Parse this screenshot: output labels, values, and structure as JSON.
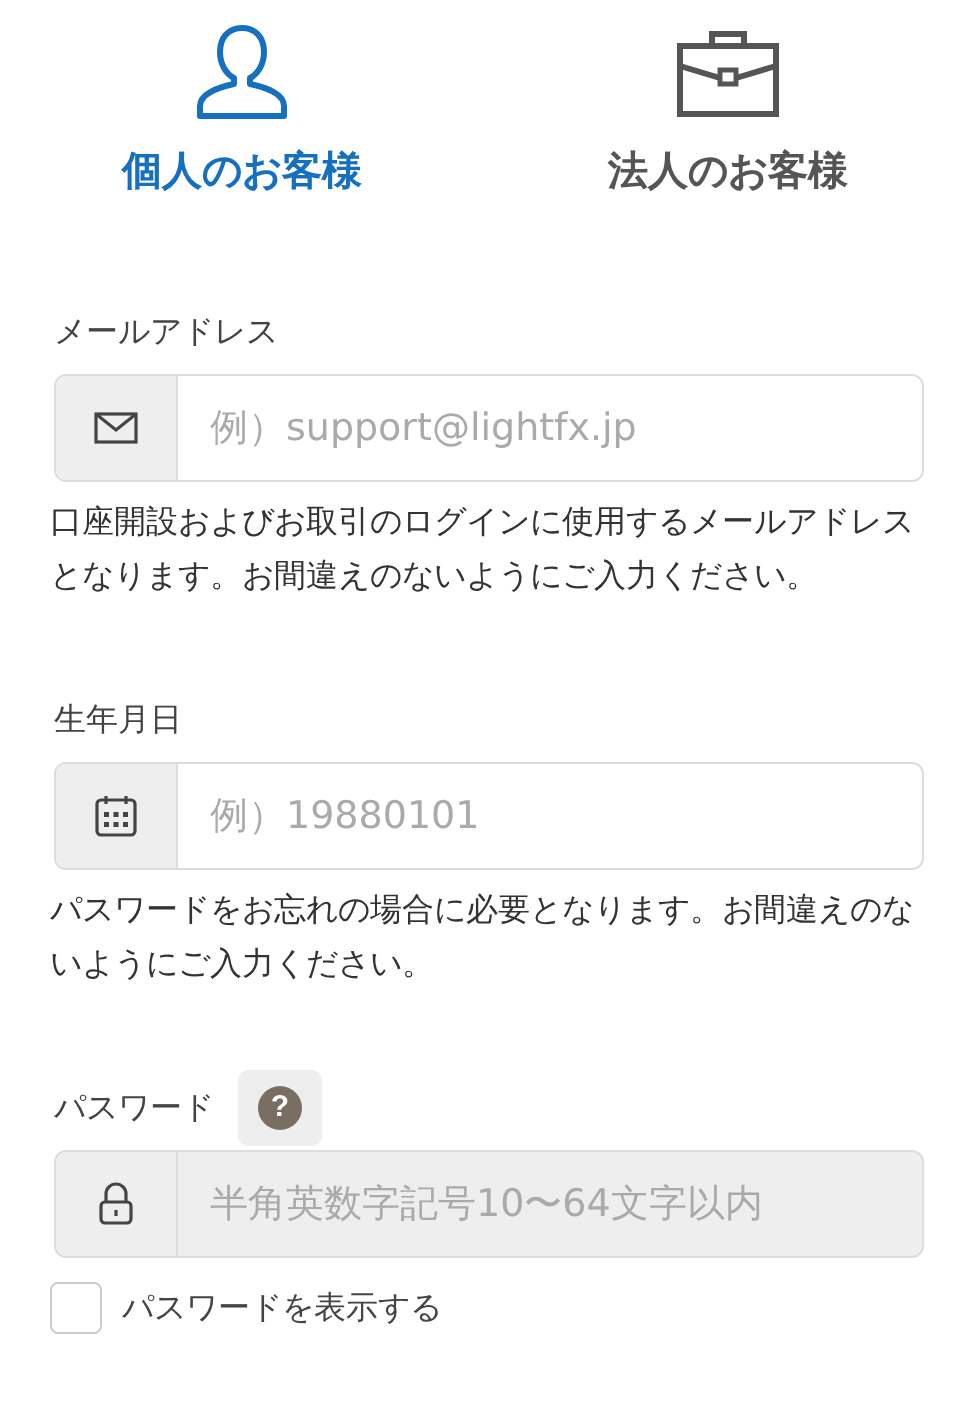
{
  "customer_tabs": [
    {
      "label": "個人のお客様",
      "kind": "person",
      "selected": true
    },
    {
      "label": "法人のお客様",
      "kind": "briefcase",
      "selected": false
    }
  ],
  "fields": [
    {
      "label": "メールアドレス",
      "kind": "mail",
      "placeholder": "例）support@lightfx.jp",
      "disabled": false,
      "hint": "口座開設およびお取引のログインに使用するメールアドレスとなります。お間違えのないようにご入力ください。"
    },
    {
      "label": "生年月日",
      "kind": "calendar",
      "placeholder": "例）19880101",
      "disabled": false,
      "hint": "パスワードをお忘れの場合に必要となります。お間違えのないようにご入力ください。"
    },
    {
      "label": "パスワード",
      "kind": "lock",
      "placeholder": "半角英数字記号10〜64文字以内",
      "disabled": true,
      "help": "?"
    }
  ],
  "show_password": {
    "label": "パスワードを表示する",
    "checked": false
  }
}
